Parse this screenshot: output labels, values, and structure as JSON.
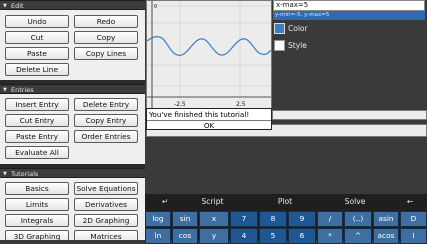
{
  "sidebar": {
    "edit": {
      "title": "Edit",
      "buttons": [
        "Undo",
        "Redo",
        "Cut",
        "Copy",
        "Paste",
        "Copy Lines",
        "Delete Line"
      ]
    },
    "entries": {
      "title": "Entries",
      "buttons": [
        "Insert Entry",
        "Delete Entry",
        "Cut Entry",
        "Copy Entry",
        "Paste Entry",
        "Order Entries",
        "Evaluate All"
      ]
    },
    "tutorials": {
      "title": "Tutorials",
      "buttons": [
        "Basics",
        "Solve Equations",
        "Limits",
        "Derivatives",
        "Integrals",
        "2D Graphing",
        "3D Graphing",
        "Matrices"
      ]
    }
  },
  "graph": {
    "tick_labels": [
      "-2.5",
      "2.5"
    ],
    "y_tick": "0"
  },
  "settings": {
    "xmax_field": "x-max=5",
    "hint_field": "y-min=-5, y-max=5",
    "color_label": "Color",
    "style_label": "Style",
    "color_swatch": "#3f7fbf"
  },
  "dialog": {
    "message": "You've finished this tutorial!",
    "ok_label": "OK"
  },
  "keyboard": {
    "top_row": [
      "↵",
      "Script",
      "Plot",
      "Solve",
      "←"
    ],
    "row1": [
      "log",
      "sin",
      "x",
      "7",
      "8",
      "9",
      "/",
      "(..)",
      "asin",
      "D"
    ],
    "row2": [
      "ln",
      "cos",
      "y",
      "4",
      "5",
      "6",
      "*",
      "^",
      "acos",
      "I"
    ]
  }
}
